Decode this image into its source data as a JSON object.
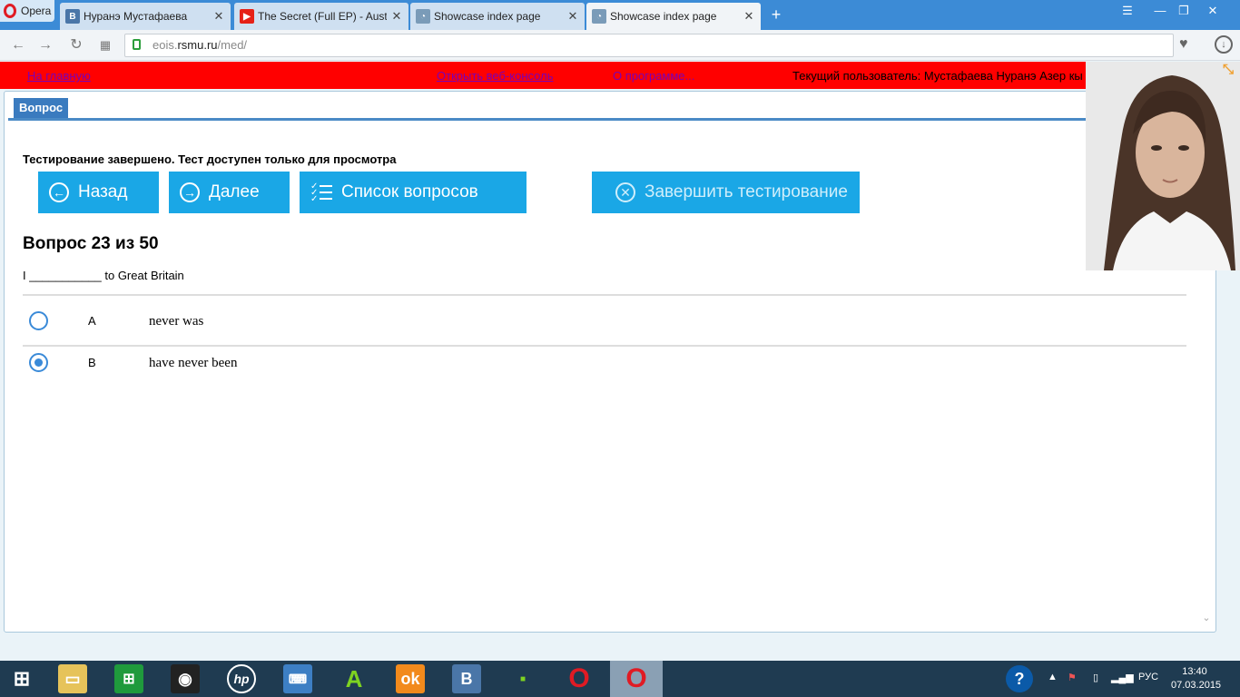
{
  "browser": {
    "menu_label": "Opera",
    "tabs": [
      {
        "title": "Нуранэ Мустафаева",
        "icon": "vk-icon",
        "active": false
      },
      {
        "title": "The Secret (Full EP) - Austin",
        "icon": "youtube-icon",
        "active": false
      },
      {
        "title": "Showcase index page",
        "icon": "showcase-icon",
        "active": false
      },
      {
        "title": "Showcase index page",
        "icon": "showcase-icon",
        "active": true
      }
    ],
    "new_tab": "+",
    "address": {
      "host_prefix": "eois.",
      "host": "rsmu.ru",
      "path": "/med/"
    }
  },
  "topnav": {
    "home_link": "На главную",
    "console_link": "Открыть веб-консоль",
    "about_link": "О программе...",
    "current_user": "Текущий пользователь: Мустафаева Нуранэ Азер кы"
  },
  "panel": {
    "tab_label": "Вопрос",
    "status_message": "Тестирование завершено. Тест доступен только для просмотра",
    "buttons": {
      "back": "Назад",
      "next": "Далее",
      "question_list": "Список вопросов",
      "finish": "Завершить тестирование"
    },
    "question_title": "Вопрос 23 из 50",
    "question_text": "I ___________ to Great Britain",
    "options": [
      {
        "letter": "A",
        "text": "never was",
        "selected": false
      },
      {
        "letter": "B",
        "text": "have never been",
        "selected": true
      }
    ]
  },
  "taskbar": {
    "language": "РУС",
    "time": "13:40",
    "date": "07.03.2015"
  },
  "colors": {
    "tab_strip": "#3c8bd6",
    "nav_strip": "#ff0000",
    "action_button": "#1aa7e6",
    "panel_tab": "#3a7bbf"
  }
}
